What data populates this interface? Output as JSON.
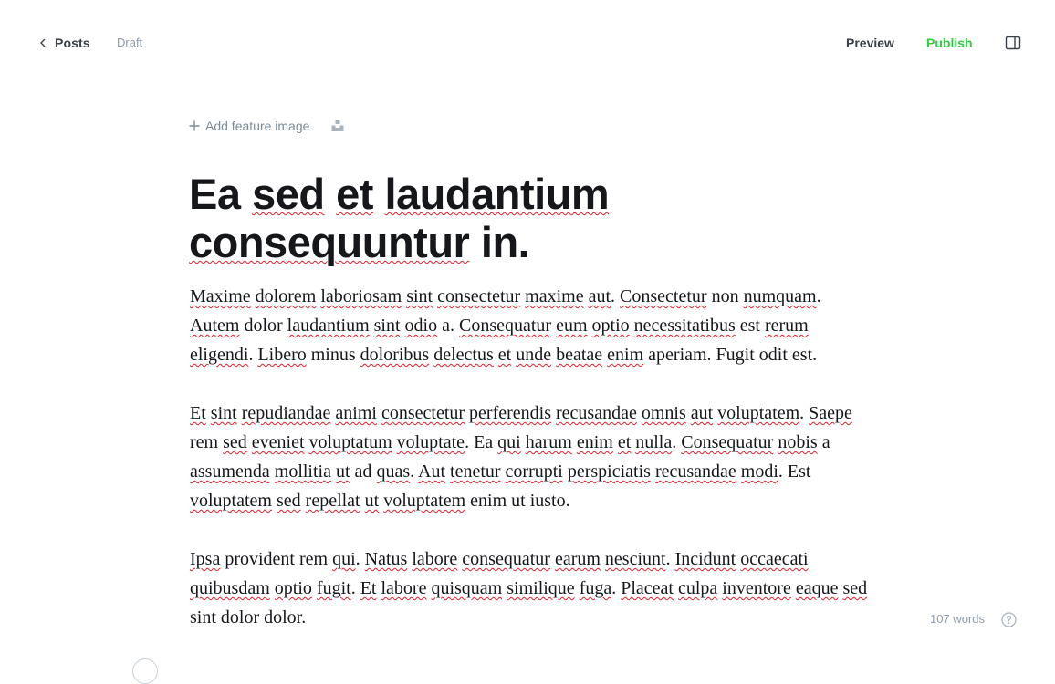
{
  "header": {
    "back_label": "Posts",
    "status": "Draft",
    "preview_label": "Preview",
    "publish_label": "Publish"
  },
  "feature_image": {
    "add_label": "Add feature image"
  },
  "post": {
    "title": [
      {
        "text": "Ea",
        "sp": false
      },
      {
        "text": "sed",
        "sp": true
      },
      {
        "text": "et",
        "sp": true
      },
      {
        "text": "laudantium",
        "sp": true
      },
      {
        "text": "consequuntur",
        "sp": true
      },
      {
        "text": "in.",
        "sp": false
      }
    ],
    "paragraphs": [
      [
        {
          "text": "Maxime",
          "sp": true
        },
        {
          "text": "dolorem",
          "sp": true
        },
        {
          "text": "laboriosam",
          "sp": true
        },
        {
          "text": "sint",
          "sp": true
        },
        {
          "text": "consectetur",
          "sp": true
        },
        {
          "text": "maxime",
          "sp": true
        },
        {
          "text": "aut",
          "sp": true
        },
        {
          "text": ".",
          "sp": false,
          "glue": true
        },
        {
          "text": "Consectetur",
          "sp": true
        },
        {
          "text": "non",
          "sp": false
        },
        {
          "text": "numquam",
          "sp": true
        },
        {
          "text": ".",
          "sp": false,
          "glue": true
        },
        {
          "text": "Autem",
          "sp": true
        },
        {
          "text": "dolor",
          "sp": false
        },
        {
          "text": "laudantium",
          "sp": true
        },
        {
          "text": "sint",
          "sp": true
        },
        {
          "text": "odio",
          "sp": true
        },
        {
          "text": "a.",
          "sp": false
        },
        {
          "text": "Consequatur",
          "sp": true
        },
        {
          "text": "eum",
          "sp": true
        },
        {
          "text": "optio",
          "sp": true
        },
        {
          "text": "necessitatibus",
          "sp": true
        },
        {
          "text": "est",
          "sp": false
        },
        {
          "text": "rerum",
          "sp": true
        },
        {
          "text": "eligendi",
          "sp": true
        },
        {
          "text": ".",
          "sp": false,
          "glue": true
        },
        {
          "text": "Libero",
          "sp": true
        },
        {
          "text": "minus",
          "sp": false
        },
        {
          "text": "doloribus",
          "sp": true
        },
        {
          "text": "delectus",
          "sp": true
        },
        {
          "text": "et",
          "sp": true
        },
        {
          "text": "unde",
          "sp": true
        },
        {
          "text": "beatae",
          "sp": true
        },
        {
          "text": "enim",
          "sp": true
        },
        {
          "text": "aperiam. Fugit odit est.",
          "sp": false
        }
      ],
      [
        {
          "text": "Et",
          "sp": true
        },
        {
          "text": "sint",
          "sp": true
        },
        {
          "text": "repudiandae",
          "sp": true
        },
        {
          "text": "animi",
          "sp": true
        },
        {
          "text": "consectetur",
          "sp": true
        },
        {
          "text": "perferendis",
          "sp": true
        },
        {
          "text": "recusandae",
          "sp": true
        },
        {
          "text": "omnis",
          "sp": true
        },
        {
          "text": "aut",
          "sp": true
        },
        {
          "text": "voluptatem",
          "sp": true
        },
        {
          "text": ".",
          "sp": false,
          "glue": true
        },
        {
          "text": "Saepe",
          "sp": true
        },
        {
          "text": "rem",
          "sp": false
        },
        {
          "text": "sed",
          "sp": true
        },
        {
          "text": "eveniet",
          "sp": true
        },
        {
          "text": "voluptatum",
          "sp": true
        },
        {
          "text": "voluptate",
          "sp": true
        },
        {
          "text": ". Ea",
          "sp": false,
          "glue": true
        },
        {
          "text": "qui",
          "sp": true
        },
        {
          "text": "harum",
          "sp": true
        },
        {
          "text": "enim",
          "sp": true
        },
        {
          "text": "et",
          "sp": true
        },
        {
          "text": "nulla",
          "sp": true
        },
        {
          "text": ".",
          "sp": false,
          "glue": true
        },
        {
          "text": "Consequatur",
          "sp": true
        },
        {
          "text": "nobis",
          "sp": true
        },
        {
          "text": "a",
          "sp": false
        },
        {
          "text": "assumenda",
          "sp": true
        },
        {
          "text": "mollitia",
          "sp": true
        },
        {
          "text": "ut",
          "sp": true
        },
        {
          "text": "ad",
          "sp": false
        },
        {
          "text": "quas",
          "sp": true
        },
        {
          "text": ".",
          "sp": false,
          "glue": true
        },
        {
          "text": "Aut",
          "sp": true
        },
        {
          "text": "tenetur",
          "sp": true
        },
        {
          "text": "corrupti",
          "sp": true
        },
        {
          "text": "perspiciatis",
          "sp": true
        },
        {
          "text": "recusandae",
          "sp": true
        },
        {
          "text": "modi",
          "sp": true
        },
        {
          "text": ". Est",
          "sp": false,
          "glue": true
        },
        {
          "text": "voluptatem",
          "sp": true
        },
        {
          "text": "sed",
          "sp": true
        },
        {
          "text": "repellat",
          "sp": true
        },
        {
          "text": "ut",
          "sp": true
        },
        {
          "text": "voluptatem",
          "sp": true
        },
        {
          "text": "enim ut iusto.",
          "sp": false
        }
      ],
      [
        {
          "text": "Ipsa",
          "sp": true
        },
        {
          "text": "provident rem",
          "sp": false
        },
        {
          "text": "qui",
          "sp": true
        },
        {
          "text": ".",
          "sp": false,
          "glue": true
        },
        {
          "text": "Natus",
          "sp": true
        },
        {
          "text": "labore",
          "sp": true
        },
        {
          "text": "consequatur",
          "sp": true
        },
        {
          "text": "earum",
          "sp": true
        },
        {
          "text": "nesciunt",
          "sp": true
        },
        {
          "text": ".",
          "sp": false,
          "glue": true
        },
        {
          "text": "Incidunt",
          "sp": true
        },
        {
          "text": "occaecati",
          "sp": true
        },
        {
          "text": "quibusdam",
          "sp": true
        },
        {
          "text": "optio",
          "sp": true
        },
        {
          "text": "fugit",
          "sp": true
        },
        {
          "text": ".",
          "sp": false,
          "glue": true
        },
        {
          "text": "Et",
          "sp": true
        },
        {
          "text": "labore",
          "sp": true
        },
        {
          "text": "quisquam",
          "sp": true
        },
        {
          "text": "similique",
          "sp": true
        },
        {
          "text": "fuga",
          "sp": true
        },
        {
          "text": ".",
          "sp": false,
          "glue": true
        },
        {
          "text": "Placeat",
          "sp": true
        },
        {
          "text": "culpa",
          "sp": true
        },
        {
          "text": "inventore",
          "sp": true
        },
        {
          "text": "eaque",
          "sp": true
        },
        {
          "text": "sed",
          "sp": true
        },
        {
          "text": "sint dolor dolor.",
          "sp": false
        }
      ]
    ]
  },
  "footer": {
    "word_count": "107 words"
  }
}
